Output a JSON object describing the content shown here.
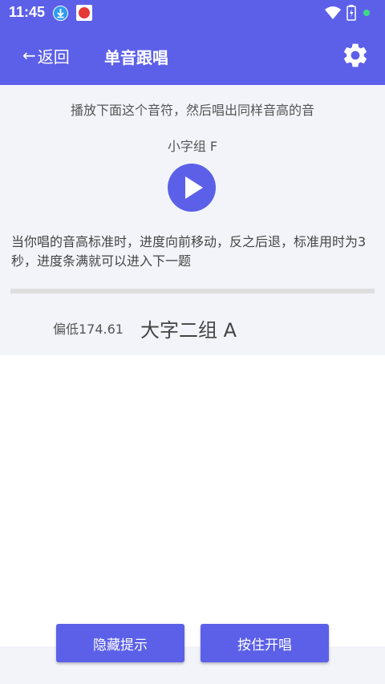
{
  "status_bar": {
    "time": "11:45",
    "icons": [
      "download-icon",
      "app-notification-icon",
      "wifi-icon",
      "battery-icon",
      "green-dot-icon"
    ]
  },
  "app_bar": {
    "back_arrow": "←",
    "back_label": "返回",
    "title": "单音跟唱",
    "settings_icon": "gear-icon"
  },
  "panel": {
    "instruction": "播放下面这个音符，然后唱出同样音高的音",
    "target_note": "小字组 F",
    "play_icon": "play-icon",
    "description": "当你唱的音高标准时，进度向前移动，反之后退，标准用时为3秒，进度条满就可以进入下一题",
    "progress": 0,
    "pitch_offset": "偏低174.61",
    "sung_note": "大字二组 A"
  },
  "buttons": {
    "hide_hint": "隐藏提示",
    "hold_to_sing": "按住开唱"
  },
  "colors": {
    "accent": "#5C60E8",
    "panel_bg": "#F3F4FA",
    "text": "#555555"
  }
}
